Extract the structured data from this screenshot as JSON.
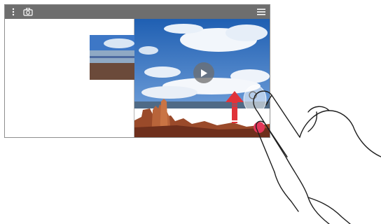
{
  "toolbar": {
    "menu_icon": "more-vertical-icon",
    "capture_icon": "camera-icon",
    "list_icon": "hamburger-icon"
  },
  "video": {
    "play_icon": "play-icon",
    "description": ""
  },
  "floating": {
    "capture_button_icon": "camera-icon",
    "back_icon": "back-arrow-icon",
    "record_button_color": "#e3375a"
  },
  "gesture": {
    "arrow_color": "#e0333a",
    "hand_icon": "hand-pointer-icon"
  },
  "colors": {
    "toolbar_bg": "#6e6e6e",
    "frame_border": "#8f8f8f"
  }
}
